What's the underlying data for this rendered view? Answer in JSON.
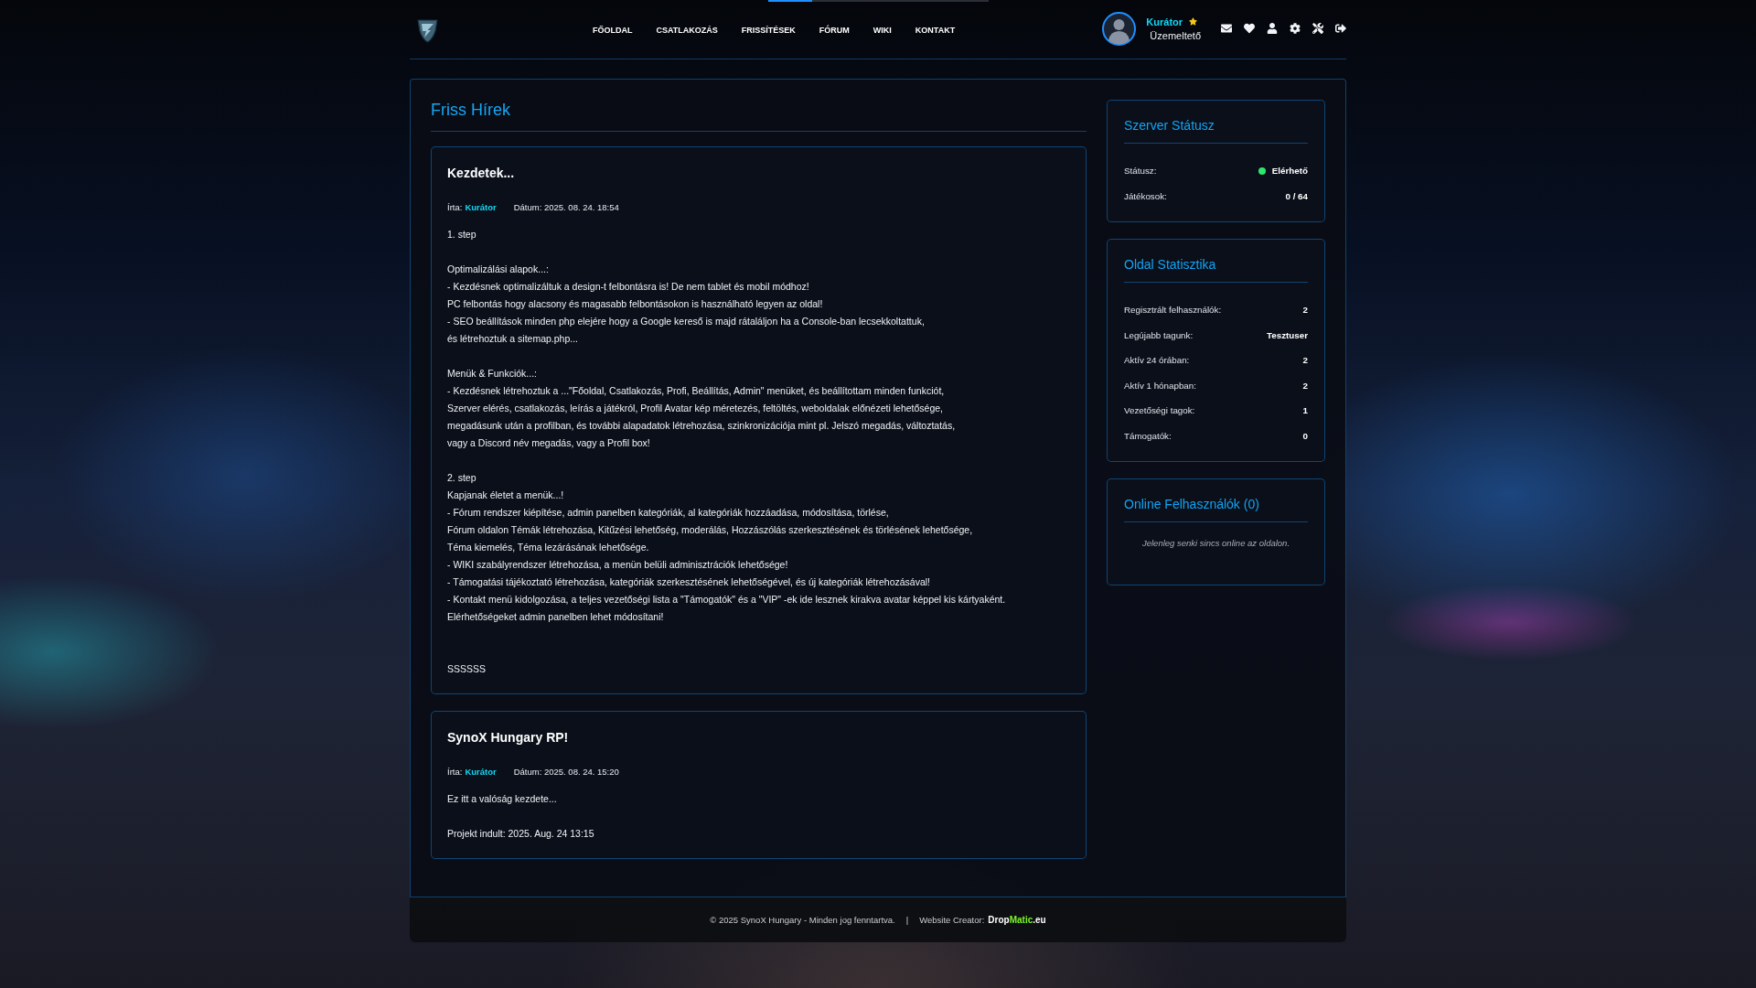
{
  "top_progress": {
    "level": 0.2
  },
  "header": {
    "nav": [
      "FŐOLDAL",
      "CSATLAKOZÁS",
      "FRISSÍTÉSEK",
      "FÓRUM",
      "WIKI",
      "KONTAKT"
    ],
    "user": {
      "name": "Kurátor",
      "role": "Üzemeltető"
    }
  },
  "news": {
    "title": "Friss Hírek",
    "posts": [
      {
        "title": "Kezdetek...",
        "author_label": "Írta:",
        "author": "Kurátor",
        "date": "Dátum: 2025. 08. 24. 18:54",
        "body": "1. step\n\nOptimalizálási alapok...:\n- Kezdésnek optimalizáltuk a design-t felbontásra is! De nem tablet és mobil módhoz!\nPC felbontás hogy alacsony és magasabb felbontásokon is használható legyen az oldal!\n- SEO beállítások minden php elejére hogy a Google kereső is majd rátaláljon ha a Console-ban lecsekkoltattuk,\nés létrehoztuk a sitemap.php...\n\nMenük & Funkciók...:\n- Kezdésnek létrehoztuk a ...\"Főoldal, Csatlakozás, Profi, Beállítás, Admin\" menüket, és beállítottam minden funkciót,\nSzerver elérés, csatlakozás, leírás a játékról, Profil Avatar kép méretezés, feltöltés, weboldalak előnézeti lehetősége,\nmegadásunk után a profilban, és további alapadatok létrehozása, szinkronizációja mint pl. Jelszó megadás, változtatás,\nvagy a Discord név megadás, vagy a Profil box!\n\n2. step\nKapjanak életet a menük...!\n- Fórum rendszer kiépítése, admin panelben kategóriák, al kategóriák hozzáadása, módosítása, törlése,\nFórum oldalon Témák létrehozása, Kitűzési lehetőség, moderálás, Hozzászólás szerkesztésének és törlésének lehetősége,\nTéma kiemelés, Téma lezárásának lehetősége.\n- WIKI szabályrendszer létrehozása, a menün belüli adminisztrációk lehetősége!\n- Támogatási tájékoztató létrehozása, kategóriák szerkesztésének lehetőségével, és új kategóriák létrehozásával!\n- Kontakt menü kidolgozása, a teljes vezetőségi lista a \"Támogatók\" és a \"VIP\" -ek ide lesznek kirakva avatar képpel kis kártyaként.\nElérhetőségeket admin panelben lehet módosítani!\n\n\nSSSSSS"
      },
      {
        "title": "SynoX Hungary RP!",
        "author_label": "Írta:",
        "author": "Kurátor",
        "date": "Dátum: 2025. 08. 24. 15:20",
        "body": "Ez itt a valóság kezdete...\n\nProjekt indult: 2025. Aug. 24 13:15"
      }
    ]
  },
  "sidebar": [
    {
      "kind": "rows",
      "title": "Szerver Státusz",
      "rows": [
        {
          "label": "Státusz:",
          "value": "Elérhető",
          "color": "#2ee66b"
        },
        {
          "label": "Játékosok:",
          "value": "0 / 64"
        }
      ]
    },
    {
      "kind": "rows",
      "title": "Oldal Statisztika",
      "rows": [
        {
          "label": "Regisztrált felhasználók:",
          "value": "2"
        },
        {
          "label": "Legújabb tagunk:",
          "value": "Tesztuser"
        },
        {
          "label": "Aktív 24 órában:",
          "value": "2"
        },
        {
          "label": "Aktív 1 hónapban:",
          "value": "2"
        },
        {
          "label": "Vezetőségi tagok:",
          "value": "1"
        },
        {
          "label": "Támogatók:",
          "value": "0"
        }
      ]
    },
    {
      "kind": "note",
      "title": "Online Felhasználók (0)",
      "note": "Jelenleg senki sincs online az oldalon."
    }
  ],
  "footer": {
    "copyright": "© 2025 SynoX Hungary - Minden jog fenntartva.",
    "separator": "|",
    "creator_label": "Website Creator:",
    "creator_link": [
      {
        "text": "Drop",
        "color": "#ffffff"
      },
      {
        "text": "Matic",
        "color": "#7cf52a"
      },
      {
        "text": ".eu",
        "color": "#ffffff"
      }
    ]
  }
}
